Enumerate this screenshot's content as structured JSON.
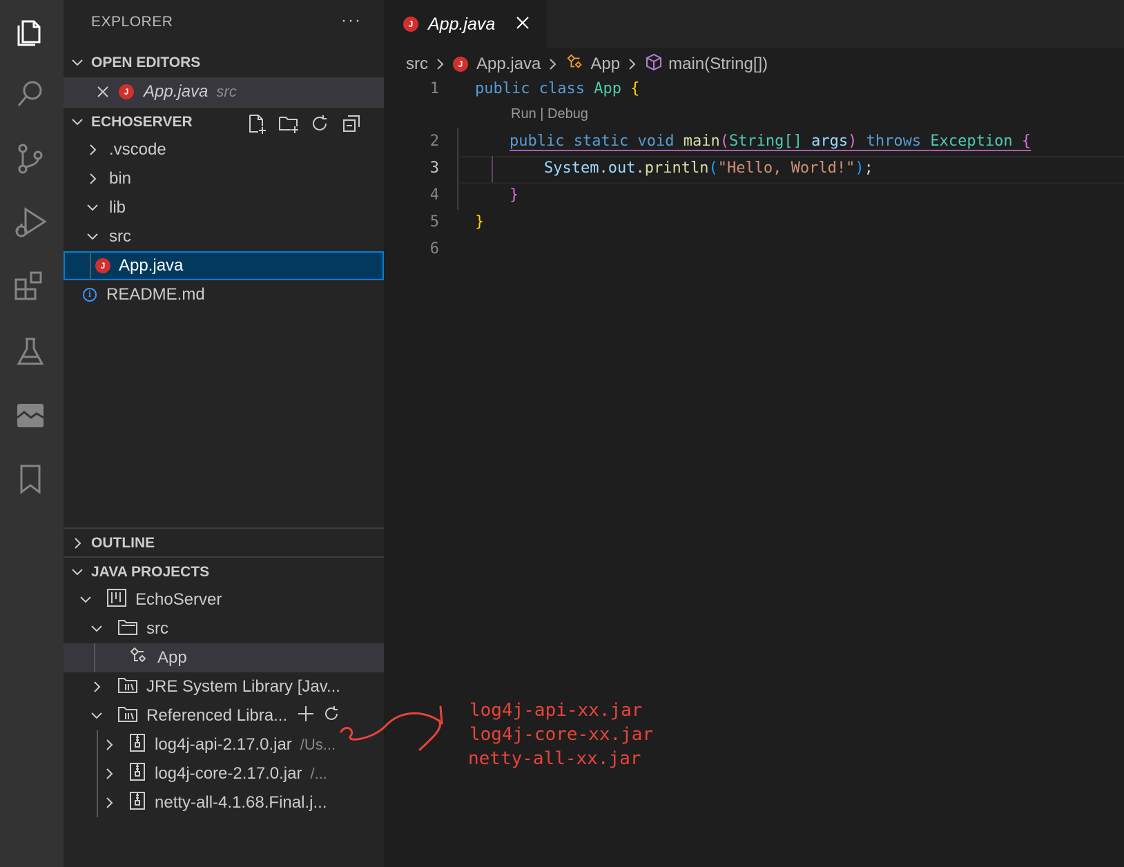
{
  "activity_bar": {
    "icons": [
      "files-icon",
      "search-icon",
      "source-control-icon",
      "run-debug-icon",
      "extensions-icon",
      "testing-icon",
      "remote-icon",
      "bookmark-icon"
    ]
  },
  "sidebar": {
    "title": "EXPLORER",
    "more_label": "···",
    "open_editors": {
      "label": "OPEN EDITORS",
      "items": [
        {
          "name": "App.java",
          "path": "src"
        }
      ]
    },
    "workspace": {
      "label": "ECHOSERVER",
      "tree": [
        {
          "name": ".vscode",
          "expanded": false
        },
        {
          "name": "bin",
          "expanded": false
        },
        {
          "name": "lib",
          "expanded": true
        },
        {
          "name": "src",
          "expanded": true
        },
        {
          "name": "App.java",
          "selected": true
        },
        {
          "name": "README.md"
        }
      ]
    },
    "outline": {
      "label": "OUTLINE"
    },
    "java_projects": {
      "label": "JAVA PROJECTS",
      "project": "EchoServer",
      "src": "src",
      "cls": "App",
      "jre": "JRE System Library [Jav...",
      "ref_libs": "Referenced Libra...",
      "jars": [
        {
          "name": "log4j-api-2.17.0.jar",
          "path": "/Us..."
        },
        {
          "name": "log4j-core-2.17.0.jar",
          "path": "/..."
        },
        {
          "name": "netty-all-4.1.68.Final.j...",
          "path": ""
        }
      ]
    }
  },
  "tab": {
    "label": "App.java"
  },
  "breadcrumbs": {
    "folder": "src",
    "file": "App.java",
    "cls": "App",
    "method": "main(String[])"
  },
  "editor": {
    "line_numbers": [
      "1",
      "2",
      "3",
      "4",
      "5",
      "6"
    ],
    "codelens": "Run | Debug",
    "lines": {
      "l1": {
        "kw1": "public",
        "kw2": "class",
        "cls": "App",
        "brace": "{"
      },
      "l2": {
        "kw1": "public",
        "kw2": "static",
        "kw3": "void",
        "fn": "main",
        "p_open": "(",
        "type": "String[]",
        "arg": "args",
        "p_close": ")",
        "kw4": "throws",
        "exc": "Exception",
        "brace": "{"
      },
      "l3": {
        "obj": "System",
        "dot1": ".",
        "field": "out",
        "dot2": ".",
        "fn": "println",
        "p_open": "(",
        "str": "\"Hello, World!\"",
        "p_close": ")",
        "semi": ";"
      },
      "l4": {
        "brace": "}"
      },
      "l5": {
        "brace": "}"
      }
    }
  },
  "annotation": {
    "lines": [
      "log4j-api-xx.jar",
      "log4j-core-xx.jar",
      "netty-all-xx.jar"
    ],
    "color": "#e8443a"
  }
}
